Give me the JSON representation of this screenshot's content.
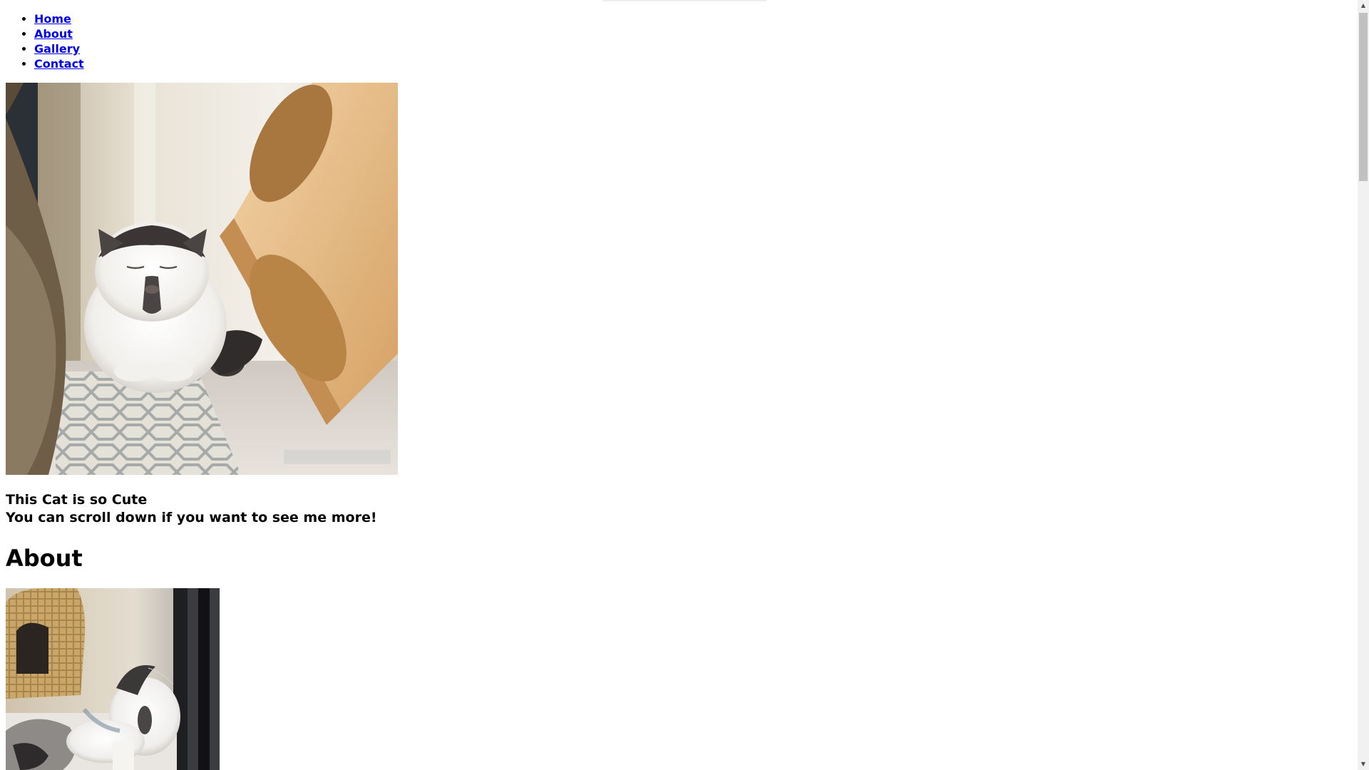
{
  "nav": {
    "items": [
      {
        "label": "Home"
      },
      {
        "label": "About"
      },
      {
        "label": "Gallery"
      },
      {
        "label": "Contact"
      }
    ]
  },
  "hero": {
    "photo_icon": "cat-photo-loaf",
    "caption_line1": "This Cat is so Cute",
    "caption_line2": "You can scroll down if you want to see me more!"
  },
  "about": {
    "heading": "About",
    "photo_icon": "cat-photo-window"
  },
  "scrollbar": {
    "up_icon": "▲",
    "down_icon": "▼"
  },
  "colors": {
    "link": "#0000EE",
    "text": "#000000",
    "background": "#FFFFFF"
  }
}
